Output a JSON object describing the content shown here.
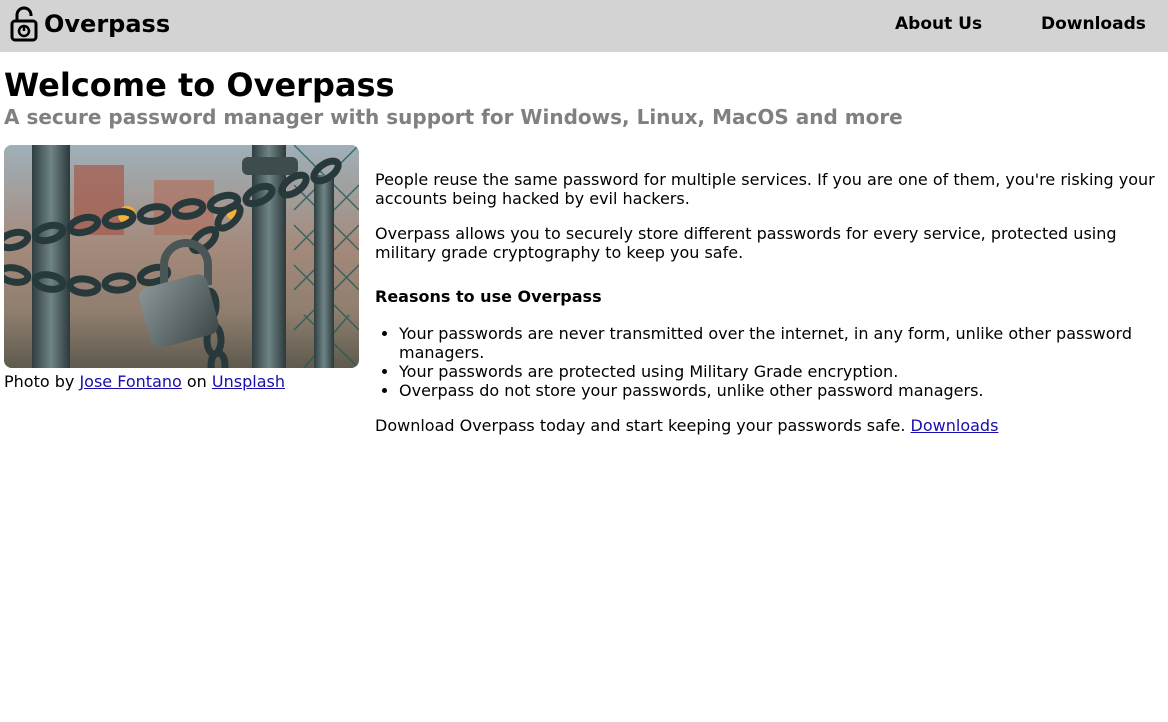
{
  "navbar": {
    "brand": "Overpass",
    "brand_icon": "unlocked-padlock-icon",
    "links": [
      {
        "label": "About Us"
      },
      {
        "label": "Downloads"
      }
    ]
  },
  "hero": {
    "title": "Welcome to Overpass",
    "subtitle": "A secure password manager with support for Windows, Linux, MacOS and more"
  },
  "photo": {
    "alt": "Chained padlock on a gate",
    "caption_prefix": "Photo by",
    "author": "Jose Fontano",
    "caption_middle": "on",
    "source": "Unsplash"
  },
  "content": {
    "paragraph1": "People reuse the same password for multiple services. If you are one of them, you're risking your accounts being hacked by evil hackers.",
    "paragraph2": "Overpass allows you to securely store different passwords for every service, protected using military grade cryptography to keep you safe.",
    "reasons_heading": "Reasons to use Overpass",
    "reasons": [
      "Your passwords are never transmitted over the internet, in any form, unlike other password managers.",
      "Your passwords are protected using Military Grade encryption.",
      "Overpass do not store your passwords, unlike other password managers."
    ],
    "cta_text": "Download Overpass today and start keeping your passwords safe.",
    "cta_link": "Downloads"
  },
  "colors": {
    "navbar_bg": "#d3d3d3",
    "subtitle": "#808080",
    "link": "#1a0dab"
  }
}
